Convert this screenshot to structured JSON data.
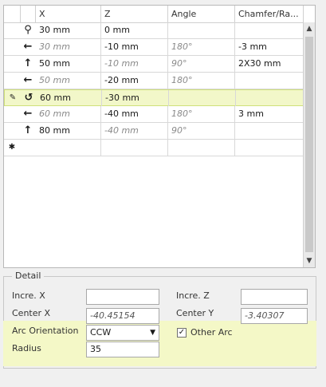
{
  "grid": {
    "columns": [
      "X",
      "Z",
      "Angle",
      "Chamfer/Ra..."
    ],
    "rows": [
      {
        "icon": "location-pin-icon",
        "glyph": "⚲",
        "x": "30 mm",
        "x_ro": false,
        "z": "0 mm",
        "z_ro": false,
        "angle": "",
        "chamfer": ""
      },
      {
        "icon": "arrow-left-icon",
        "glyph": "←",
        "x": "30 mm",
        "x_ro": true,
        "z": "-10 mm",
        "z_ro": false,
        "angle": "180°",
        "chamfer": "-3 mm"
      },
      {
        "icon": "arrow-up-icon",
        "glyph": "↑",
        "x": "50 mm",
        "x_ro": false,
        "z": "-10 mm",
        "z_ro": true,
        "angle": "90°",
        "chamfer": "2X30 mm"
      },
      {
        "icon": "arrow-left-icon",
        "glyph": "←",
        "x": "50 mm",
        "x_ro": true,
        "z": "-20 mm",
        "z_ro": false,
        "angle": "180°",
        "chamfer": ""
      },
      {
        "icon": "arc-ccw-icon",
        "glyph": "↺",
        "x": "60 mm",
        "x_ro": false,
        "z": "-30 mm",
        "z_ro": false,
        "angle": "",
        "chamfer": "",
        "selected": true,
        "indicator": "✎"
      },
      {
        "icon": "arrow-left-icon",
        "glyph": "←",
        "x": "60 mm",
        "x_ro": true,
        "z": "-40 mm",
        "z_ro": false,
        "angle": "180°",
        "chamfer": "3 mm"
      },
      {
        "icon": "arrow-up-icon",
        "glyph": "↑",
        "x": "80 mm",
        "x_ro": false,
        "z": "-40 mm",
        "z_ro": true,
        "angle": "90°",
        "chamfer": ""
      },
      {
        "icon": "",
        "glyph": "",
        "x": "",
        "x_ro": false,
        "z": "",
        "z_ro": false,
        "angle": "",
        "chamfer": "",
        "indicator": "✱"
      }
    ]
  },
  "detail": {
    "title": "Detail",
    "incre_x_label": "Incre. X",
    "incre_x_value": "",
    "incre_z_label": "Incre. Z",
    "incre_z_value": "",
    "center_x_label": "Center X",
    "center_x_value": "-40.45154",
    "center_y_label": "Center Y",
    "center_y_value": "-3.40307",
    "arc_orientation_label": "Arc Orientation",
    "arc_orientation_value": "CCW",
    "other_arc_label": "Other Arc",
    "other_arc_checked": "✓",
    "radius_label": "Radius",
    "radius_value": "35"
  }
}
